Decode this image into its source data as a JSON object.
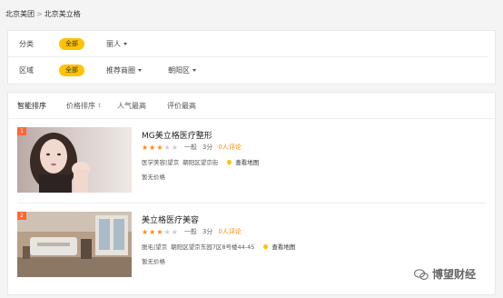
{
  "breadcrumb": {
    "items": [
      "北京美团",
      "北京美立格"
    ],
    "separator": ">"
  },
  "filters": {
    "category": {
      "label": "分类",
      "all_label": "全部",
      "options": [
        "丽人"
      ]
    },
    "region": {
      "label": "区域",
      "all_label": "全部",
      "options": [
        "推荐商圈",
        "朝阳区"
      ]
    }
  },
  "sort": {
    "items": [
      "智能排序",
      "价格排序",
      "人气最高",
      "评价最高"
    ],
    "price_arrows": "↕"
  },
  "listings": [
    {
      "rank": "1",
      "title": "MG美立格医疗整形",
      "rating_stars": 3,
      "rating_text": "一般",
      "score": "3分",
      "reviews": "0人评论",
      "area": "医学美容|望京",
      "address": "朝阳区望京街",
      "map_link": "查看地图",
      "price": "暂无价格"
    },
    {
      "rank": "2",
      "title": "美立格医疗美容",
      "rating_stars": 3,
      "rating_text": "一般",
      "score": "3分",
      "reviews": "0人评论",
      "area": "脱毛|望京",
      "address": "朝阳区望京东园7区8号楼44-45",
      "map_link": "查看地图",
      "price": "暂无价格"
    }
  ],
  "watermark": {
    "text": "博望财经"
  }
}
